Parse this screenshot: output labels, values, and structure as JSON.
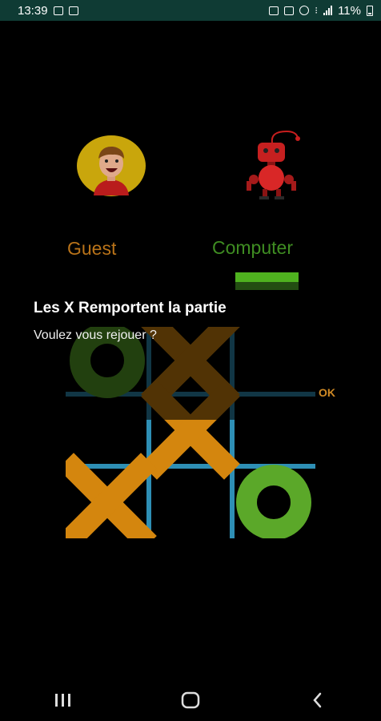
{
  "status_bar": {
    "time": "13:39",
    "battery": "11%"
  },
  "players": {
    "guest": {
      "name": "Guest",
      "color": "#b97319"
    },
    "computer": {
      "name": "Computer",
      "color": "#3f8d22"
    }
  },
  "board": {
    "cells": [
      "O",
      "X",
      "",
      "",
      "X",
      "",
      "X",
      "",
      "O"
    ],
    "x_color": "#d4860e",
    "o_color": "#5ba829",
    "grid_color": "#2e8fb5"
  },
  "dialog": {
    "title": "Les X Remportent la partie",
    "message": "Voulez vous rejouer ?",
    "ok_label": "OK"
  },
  "navigation": {
    "recent_icon": "recent-apps-icon",
    "home_icon": "home-icon",
    "back_icon": "back-icon"
  }
}
